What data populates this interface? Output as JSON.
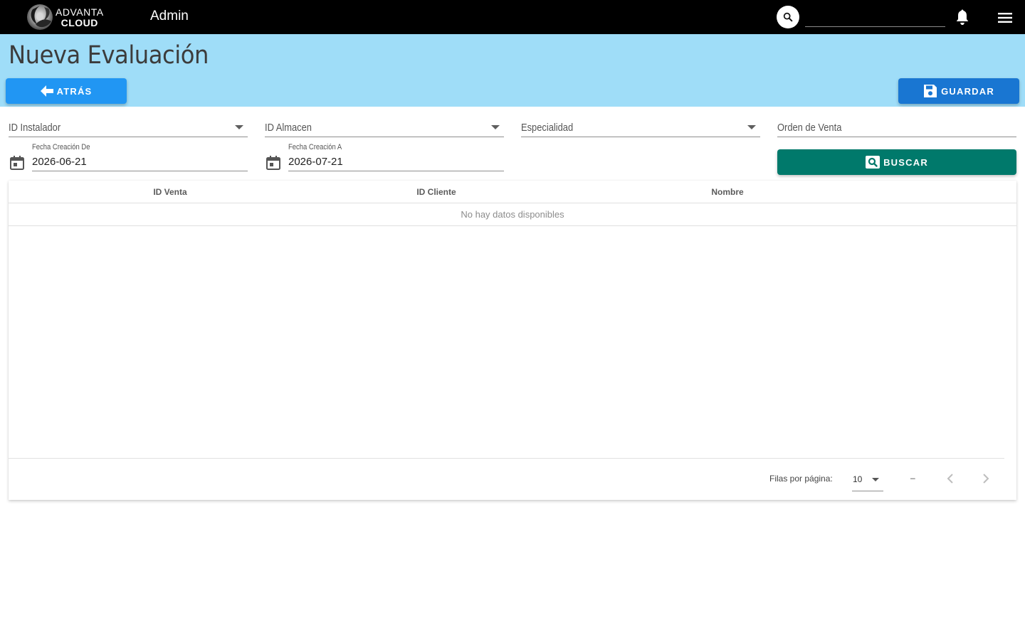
{
  "app": {
    "logo_line1": "ADVANTA",
    "logo_line2": "CLOUD",
    "title": "Admin",
    "search_placeholder": ""
  },
  "page": {
    "title": "Nueva Evaluación",
    "back_label": "ATRÁS",
    "save_label": "GUARDAR"
  },
  "filters": {
    "instalador_label": "ID Instalador",
    "almacen_label": "ID Almacen",
    "especialidad_label": "Especialidad",
    "orden_label": "Orden de Venta",
    "fecha_de_label": "Fecha Creación De",
    "fecha_de_value": "2026-06-21",
    "fecha_a_label": "Fecha Creación A",
    "fecha_a_value": "2026-07-21",
    "buscar_label": "BUSCAR"
  },
  "table": {
    "columns": [
      "ID Venta",
      "ID Cliente",
      "Nombre"
    ],
    "empty_text": "No hay datos disponibles",
    "rows_per_page_label": "Filas por página:",
    "rows_per_page_value": "10",
    "range_text": "–"
  },
  "colors": {
    "topbar": "#000000",
    "header_band": "#9fddf8",
    "back_button": "#2196f3",
    "save_button": "#1976d2",
    "buscar_button": "#00796b"
  },
  "icons": {
    "search": "search-icon",
    "bell": "bell-icon",
    "menu": "menu-icon",
    "back": "arrow-left-icon",
    "save": "floppy-disk-icon",
    "calendar": "calendar-icon",
    "buscar": "search-box-icon",
    "prev": "chevron-left-icon",
    "next": "chevron-right-icon"
  }
}
